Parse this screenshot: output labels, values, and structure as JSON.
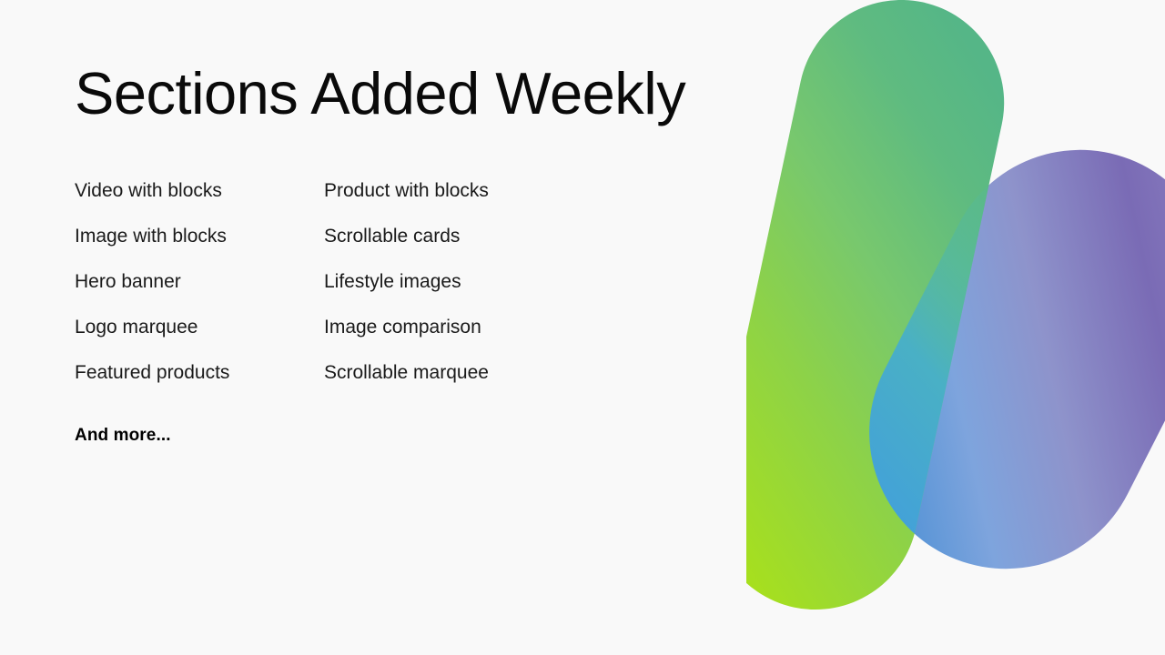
{
  "background_color": "#f9f9f9",
  "heading": {
    "title": "Sections Added Weekly"
  },
  "sections": {
    "left_column": [
      "Video with blocks",
      "Image with blocks",
      "Hero banner",
      "Logo marquee",
      "Featured products"
    ],
    "right_column": [
      "Product with blocks",
      "Scrollable cards",
      "Lifestyle images",
      "Image comparison",
      "Scrollable marquee"
    ],
    "footer_note": "And more..."
  },
  "decorative_mark": {
    "name": "gradient-n-mark",
    "colors": {
      "green_top": "#5cba84",
      "green_mid": "#7ecb6a",
      "lime_bottom": "#a5de22",
      "teal_blend": "#48b0cf",
      "blue": "#4a8fd4",
      "blue_light": "#93b6e4",
      "purple": "#7a6bb5",
      "purple_light": "#a79ccd"
    }
  }
}
